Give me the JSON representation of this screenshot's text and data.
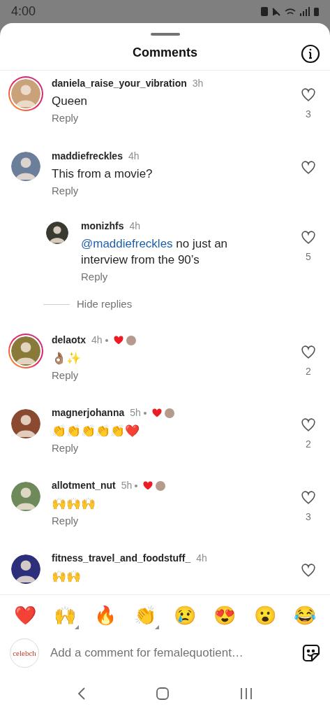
{
  "status_bar": {
    "time": "4:00"
  },
  "sheet": {
    "title": "Comments"
  },
  "comments": [
    {
      "username": "daniela_raise_your_vibration",
      "time": "3h",
      "text": "Queen",
      "reply_label": "Reply",
      "likes": "3",
      "story_ring": true,
      "author_liked": false
    },
    {
      "username": "maddiefreckles",
      "time": "4h",
      "text": "This from a movie?",
      "reply_label": "Reply",
      "story_ring": false,
      "author_liked": false,
      "replies": [
        {
          "username": "monizhfs",
          "time": "4h",
          "mention": "@maddiefreckles",
          "text": "no just an interview from the 90’s",
          "reply_label": "Reply",
          "likes": "5"
        }
      ],
      "hide_replies": "Hide replies"
    },
    {
      "username": "delaotx",
      "time": "4h",
      "text": "👌🏽✨",
      "reply_label": "Reply",
      "likes": "2",
      "story_ring": true,
      "author_liked": true
    },
    {
      "username": "magnerjohanna",
      "time": "5h",
      "text": "👏👏👏👏👏❤️",
      "reply_label": "Reply",
      "likes": "2",
      "story_ring": false,
      "author_liked": true
    },
    {
      "username": "allotment_nut",
      "time": "5h",
      "text": "🙌🙌🙌",
      "reply_label": "Reply",
      "likes": "3",
      "story_ring": false,
      "author_liked": true
    },
    {
      "username": "fitness_travel_and_foodstuff_",
      "time": "4h",
      "text": "🙌🙌",
      "story_ring": false,
      "author_liked": false
    }
  ],
  "emoji_bar": [
    {
      "emoji": "❤️",
      "has_variants": false
    },
    {
      "emoji": "🙌",
      "has_variants": true
    },
    {
      "emoji": "🔥",
      "has_variants": false
    },
    {
      "emoji": "👏",
      "has_variants": true
    },
    {
      "emoji": "😢",
      "has_variants": false
    },
    {
      "emoji": "😍",
      "has_variants": false
    },
    {
      "emoji": "😮",
      "has_variants": false
    },
    {
      "emoji": "😂",
      "has_variants": false
    }
  ],
  "composer": {
    "avatar_text": "celebch",
    "placeholder": "Add a comment for femalequotient…"
  }
}
